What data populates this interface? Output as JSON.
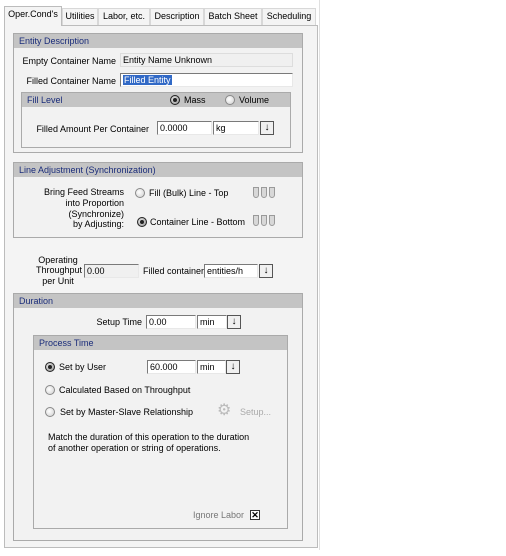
{
  "tabs": [
    {
      "label": "Oper.Cond's",
      "active": true
    },
    {
      "label": "Utilities"
    },
    {
      "label": "Labor, etc."
    },
    {
      "label": "Description"
    },
    {
      "label": "Batch Sheet"
    },
    {
      "label": "Scheduling"
    }
  ],
  "entity": {
    "title": "Entity Description",
    "empty_label": "Empty Container Name",
    "empty_value": "Entity Name Unknown",
    "filled_label": "Filled Container Name",
    "filled_value": "Filled Entity"
  },
  "fill_level": {
    "title": "Fill Level",
    "mass_label": "Mass",
    "volume_label": "Volume",
    "selected": "Mass",
    "amount_label": "Filled Amount Per Container",
    "amount_value": "0.0000",
    "unit": "kg"
  },
  "line_adjust": {
    "title": "Line Adjustment (Synchronization)",
    "prompt": [
      "Bring Feed Streams",
      "into Proportion",
      "(Synchronize)",
      "by Adjusting:"
    ],
    "option_top": "Fill (Bulk) Line - Top",
    "option_bottom": "Container Line - Bottom",
    "selected": "Container Line - Bottom"
  },
  "throughput": {
    "label": [
      "Operating",
      "Throughput",
      "per Unit"
    ],
    "value": "0.00",
    "basis_label": "Filled container",
    "unit": "entities/h"
  },
  "duration": {
    "title": "Duration",
    "setup_label": "Setup Time",
    "setup_value": "0.00",
    "setup_unit": "min"
  },
  "process_time": {
    "title": "Process Time",
    "set_by_user": "Set by User",
    "value": "60.000",
    "unit": "min",
    "calculated": "Calculated Based on Throughput",
    "master_slave": "Set by Master-Slave Relationship",
    "setup_button": "Setup...",
    "selected": "Set by User",
    "description": [
      "Match the duration of this operation to the duration",
      "of another operation or string of operations."
    ],
    "ignore_labor_label": "Ignore Labor",
    "ignore_labor_checked": true,
    "checkbox_mark": "✕"
  },
  "icons": {
    "dropdown": "↓"
  }
}
